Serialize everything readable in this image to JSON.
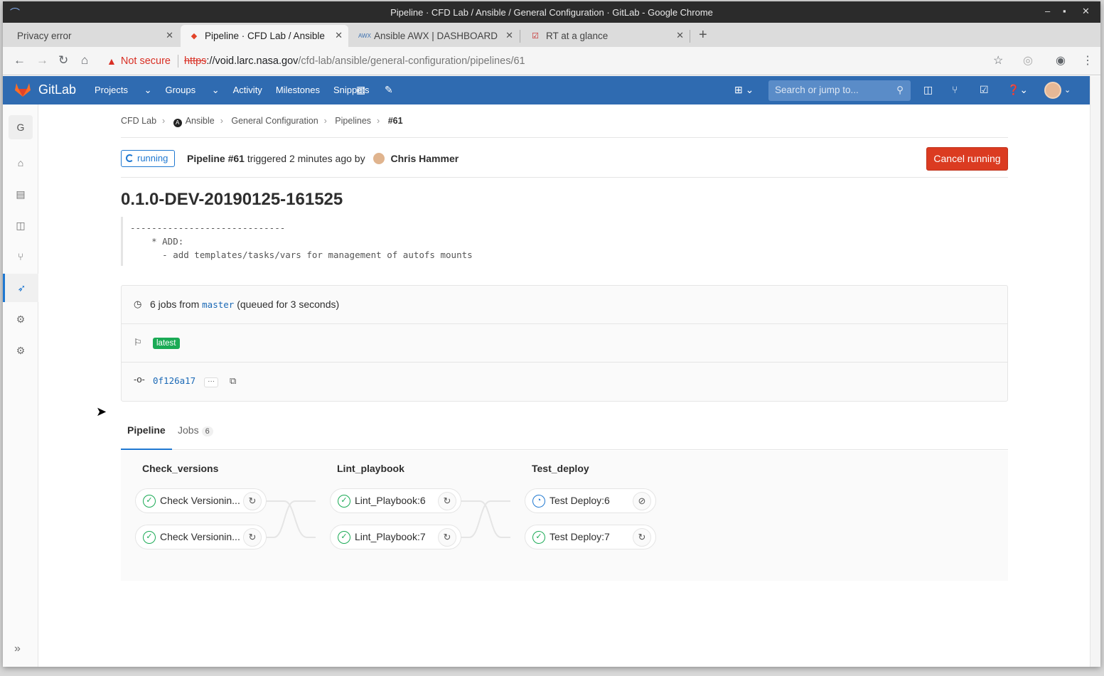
{
  "window": {
    "title": "Pipeline · CFD Lab / Ansible / General Configuration · GitLab - Google Chrome",
    "controls": [
      "–",
      "▪",
      "✕"
    ]
  },
  "browser_tabs": [
    {
      "label": "Privacy error",
      "active": false
    },
    {
      "label": "Pipeline · CFD Lab / Ansible",
      "active": true
    },
    {
      "label": "Ansible AWX | DASHBOARD",
      "active": false
    },
    {
      "label": "RT at a glance",
      "active": false
    }
  ],
  "address_bar": {
    "security_label": "Not secure",
    "scheme": "https",
    "host": "://void.larc.nasa.gov",
    "path": "/cfd-lab/ansible/general-configuration/pipelines/61"
  },
  "gitlab_header": {
    "brand": "GitLab",
    "nav": [
      "Projects",
      "Groups",
      "Activity",
      "Milestones",
      "Snippets"
    ],
    "search_placeholder": "Search or jump to..."
  },
  "sidebar": {
    "project_letter": "G",
    "collapse_label": "»"
  },
  "breadcrumb": {
    "items": [
      "CFD Lab",
      "Ansible",
      "General Configuration",
      "Pipelines"
    ],
    "current": "#61"
  },
  "pipeline": {
    "status": "running",
    "pipeline_label": "Pipeline #61",
    "triggered_text": "triggered 2 minutes ago by",
    "author": "Chris Hammer",
    "cancel_label": "Cancel running",
    "title": "0.1.0-DEV-20190125-161525",
    "description": "-----------------------------\n    * ADD:\n      - add templates/tasks/vars for management of autofs mounts",
    "jobs_count_text": "6 jobs from",
    "branch": "master",
    "queued_text": "(queued for 3 seconds)",
    "tag": "latest",
    "commit": "0f126a17",
    "more_label": "···"
  },
  "tabs": {
    "pipeline_label": "Pipeline",
    "jobs_label": "Jobs",
    "jobs_count": "6"
  },
  "stages": [
    {
      "name": "Check_versions",
      "jobs": [
        {
          "name": "Check Versionin...",
          "status": "success",
          "action": "retry"
        },
        {
          "name": "Check Versionin...",
          "status": "success",
          "action": "retry"
        }
      ]
    },
    {
      "name": "Lint_playbook",
      "jobs": [
        {
          "name": "Lint_Playbook:6",
          "status": "success",
          "action": "retry"
        },
        {
          "name": "Lint_Playbook:7",
          "status": "success",
          "action": "retry"
        }
      ]
    },
    {
      "name": "Test_deploy",
      "jobs": [
        {
          "name": "Test Deploy:6",
          "status": "running",
          "action": "cancel"
        },
        {
          "name": "Test Deploy:7",
          "status": "success",
          "action": "retry"
        }
      ]
    }
  ],
  "colors": {
    "header_blue": "#2f6bb1",
    "success_green": "#1aaa55",
    "running_blue": "#1f78d1",
    "cancel_red": "#db3b21"
  }
}
